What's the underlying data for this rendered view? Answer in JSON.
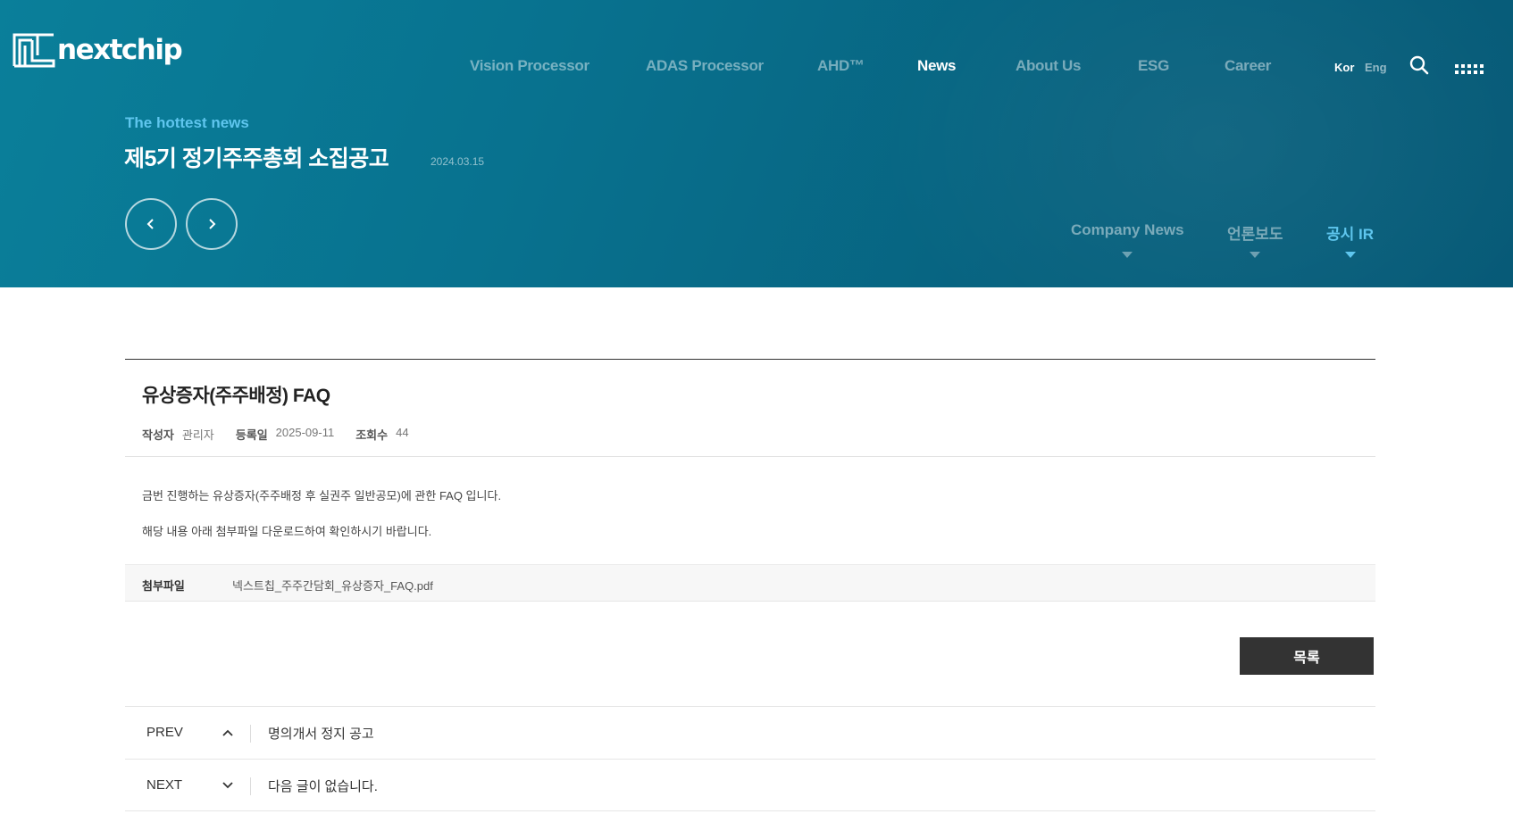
{
  "brand": {
    "logo_text": "nextchip"
  },
  "gnb": {
    "items": [
      {
        "label": "Vision Processor"
      },
      {
        "label": "ADAS Processor"
      },
      {
        "label": "AHD™"
      },
      {
        "label": "News",
        "active": true
      },
      {
        "label": "About Us"
      },
      {
        "label": "ESG"
      },
      {
        "label": "Career"
      }
    ],
    "lang": {
      "kor": "Kor",
      "eng": "Eng"
    },
    "icons": {
      "search": "search-icon",
      "menu": "grid-menu-icon"
    }
  },
  "hero": {
    "label": "The hottest news",
    "title": "제5기 정기주주총회 소집공고",
    "date": "2024.03.15",
    "icons": {
      "prev": "chevron-left-icon",
      "next": "chevron-right-icon"
    }
  },
  "subtabs": [
    {
      "label": "Company News"
    },
    {
      "label": "언론보도"
    },
    {
      "label": "공시 IR",
      "active": true
    }
  ],
  "post": {
    "title": "유상증자(주주배정) FAQ",
    "meta": {
      "author_label": "작성자",
      "author": "관리자",
      "date_label": "등록일",
      "date": "2025-09-11",
      "views_label": "조회수",
      "views": "44"
    },
    "body": [
      "금번 진행하는 유상증자(주주배정 후 실권주 일반공모)에 관한 FAQ 입니다.",
      "해당 내용 아래 첨부파일 다운로드하여 확인하시기 바랍니다."
    ],
    "attachment": {
      "label": "첨부파일",
      "file": "넥스트칩_주주간담회_유상증자_FAQ.pdf"
    }
  },
  "actions": {
    "list_label": "목록"
  },
  "navigation": {
    "prev": {
      "label": "PREV",
      "text": "명의개서 정지 공고"
    },
    "next": {
      "label": "NEXT",
      "text": "다음 글이 없습니다."
    }
  },
  "colors": {
    "hero_bg": "#08728f",
    "accent": "#5fc6ee",
    "button_dark": "#333333"
  }
}
